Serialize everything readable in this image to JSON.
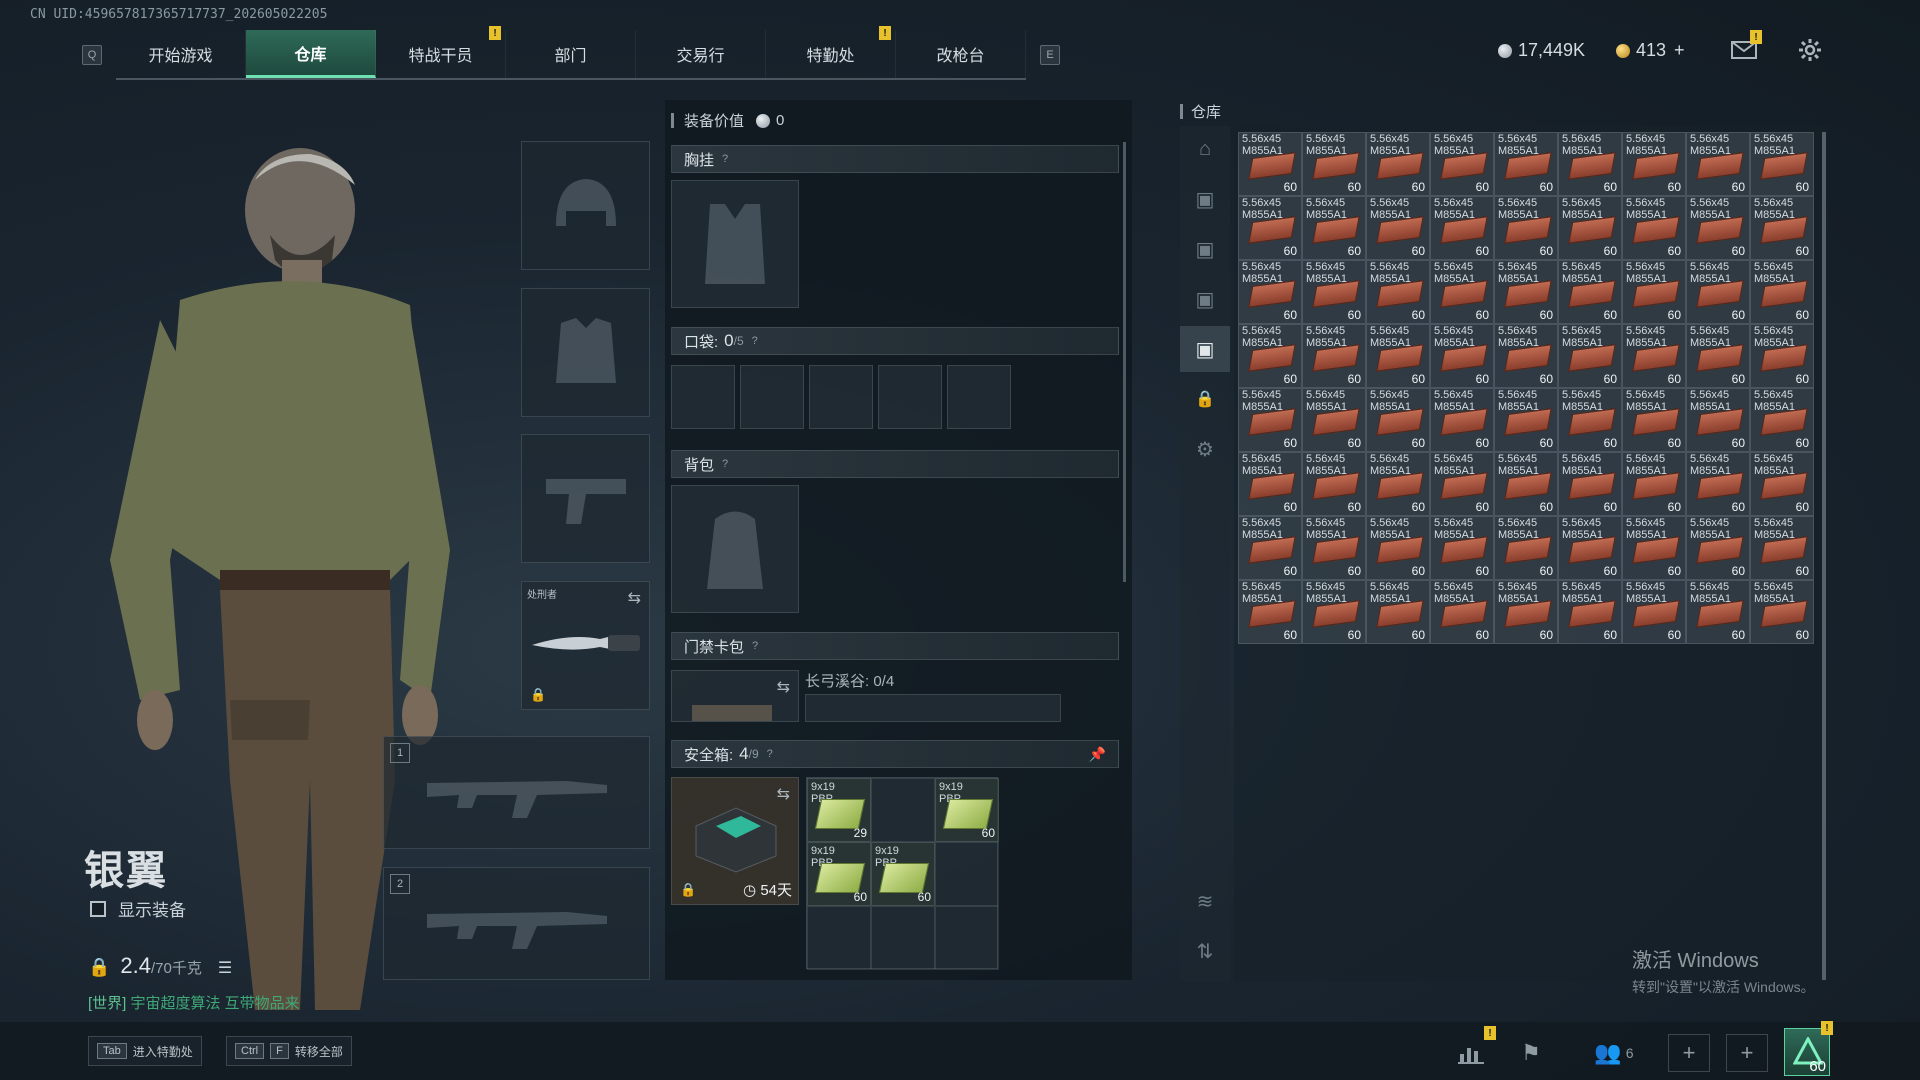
{
  "uid": "CN UID:459657817365717737_202605022205",
  "nav": {
    "left_key": "Q",
    "right_key": "E",
    "tabs": [
      {
        "label": "开始游戏",
        "active": false,
        "alert": false
      },
      {
        "label": "仓库",
        "active": true,
        "alert": false
      },
      {
        "label": "特战干员",
        "active": false,
        "alert": true
      },
      {
        "label": "部门",
        "active": false,
        "alert": false
      },
      {
        "label": "交易行",
        "active": false,
        "alert": false
      },
      {
        "label": "特勤处",
        "active": false,
        "alert": true
      },
      {
        "label": "改枪台",
        "active": false,
        "alert": false
      }
    ],
    "alert_mark": "!"
  },
  "currency": {
    "silver": "17,449K",
    "gold": "413",
    "gold_add": "+"
  },
  "icons": {
    "mail": "mail-icon",
    "settings": "gear-icon"
  },
  "character": {
    "name": "银翼",
    "show_equipment_label": "显示装备",
    "weight_current": "2.4",
    "weight_max": "/70千克",
    "world_tag": "[世界]",
    "world_message": "宇宙超度算法 互带物品来"
  },
  "equip_slots": {
    "knife_label": "处刑者",
    "weapon_1": "1",
    "weapon_2": "2"
  },
  "gear": {
    "value_label": "装备价值",
    "value": "0",
    "chest_label": "胸挂",
    "pocket_label": "口袋:",
    "pocket_count": "0",
    "pocket_max": "/5",
    "backpack_label": "背包",
    "keycard_label": "门禁卡包",
    "keycard_map": "长弓溪谷: 0/4",
    "safebox_label": "安全箱:",
    "safebox_count": "4",
    "safebox_max": "/9",
    "safebox_days": "54天",
    "qmark": "?",
    "safebox_items": [
      {
        "cal1": "9x19",
        "cal2": "PBP",
        "qty": "29"
      },
      {
        "cal1": "9x19",
        "cal2": "PBP",
        "qty": "60"
      },
      {
        "cal1": "9x19",
        "cal2": "PBP",
        "qty": "60"
      },
      {
        "cal1": "9x19",
        "cal2": "PBP",
        "qty": "60"
      }
    ]
  },
  "warehouse": {
    "title": "仓库",
    "item": {
      "cal1": "5.56x45",
      "cal2": "M855A1",
      "qty": "60"
    },
    "rows": 8,
    "cols": 9
  },
  "watermark": {
    "line1": "激活 Windows",
    "line2": "转到\"设置\"以激活 Windows。"
  },
  "bottom": {
    "tab_key": "Tab",
    "tab_label": "进入特勤处",
    "ctrl_key": "Ctrl",
    "f_key": "F",
    "move_all_label": "转移全部",
    "friends_count": "6",
    "level": "60"
  }
}
